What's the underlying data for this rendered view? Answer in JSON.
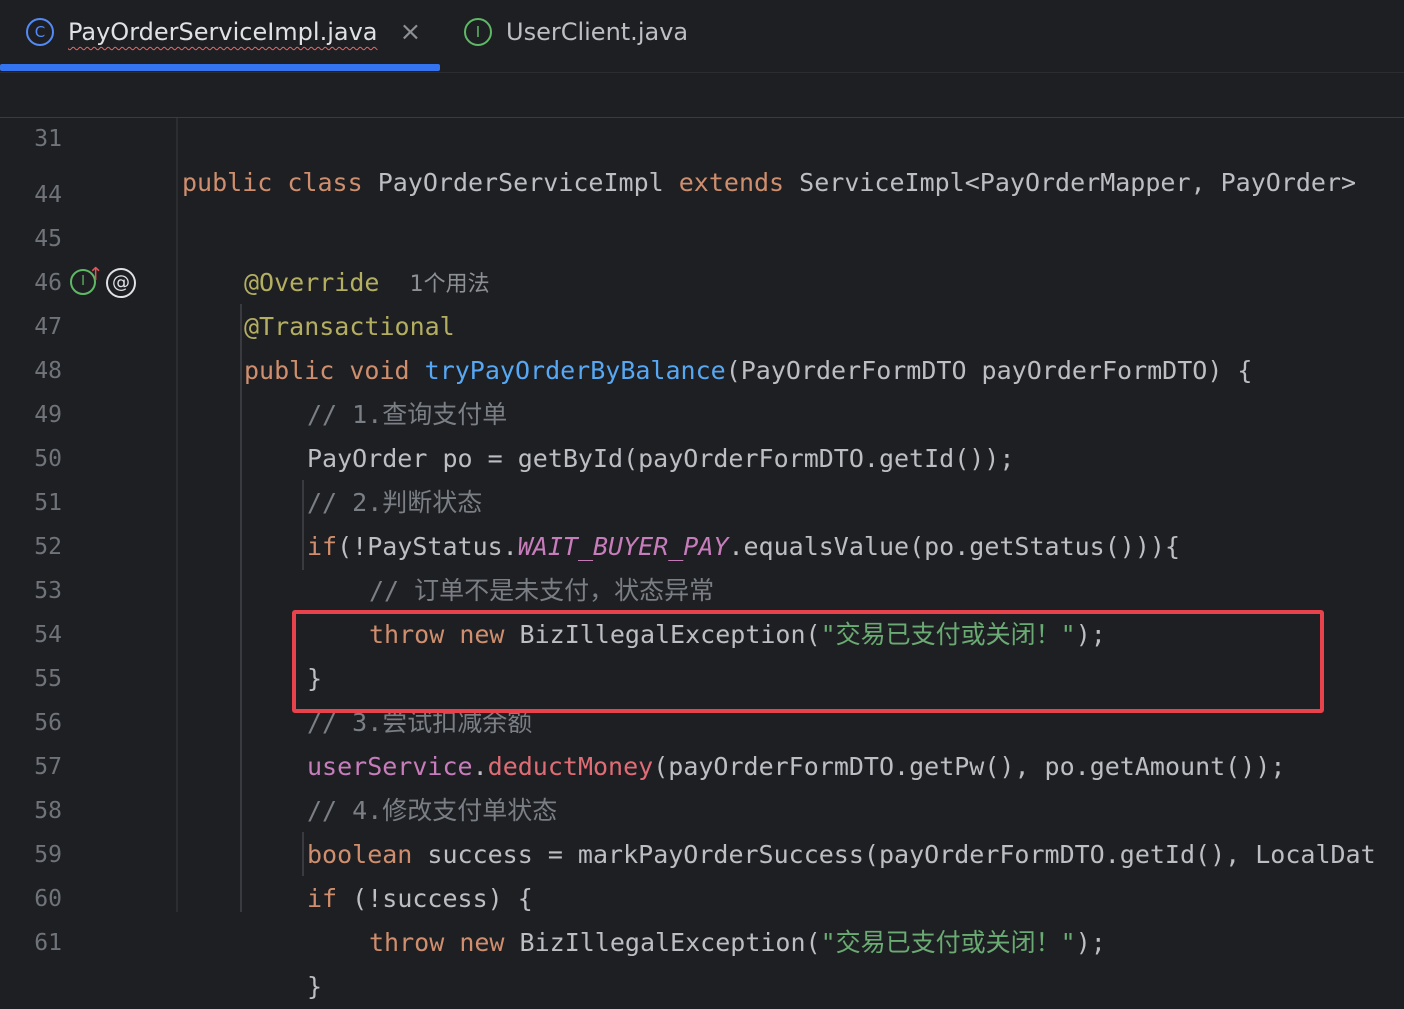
{
  "tabs": [
    {
      "label": "PayOrderServiceImpl.java",
      "icon": "class-icon",
      "icon_glyph": "C",
      "active": true,
      "close": "×"
    },
    {
      "label": "UserClient.java",
      "icon": "interface-icon",
      "icon_glyph": "I",
      "active": false
    }
  ],
  "sticky": {
    "line_number": "31",
    "kw1": "public",
    "kw2": "class",
    "name": "PayOrderServiceImpl",
    "kw3": "extends",
    "rest": "ServiceImpl<PayOrderMapper, PayOrder>"
  },
  "gutter": {
    "implements_marker": "I",
    "override_arrow": "↑",
    "annotation_marker": "@"
  },
  "lines": {
    "l44": {
      "n": "44"
    },
    "l45": {
      "n": "45",
      "ann": "@Override",
      "hint": "1个用法"
    },
    "l46": {
      "n": "46",
      "ann": "@Transactional"
    },
    "l47": {
      "n": "47",
      "kw1": "public",
      "kw2": "void",
      "fn": "tryPayOrderByBalance",
      "rest": "(PayOrderFormDTO payOrderFormDTO) {"
    },
    "l48": {
      "n": "48",
      "cm": "// 1.查询支付单"
    },
    "l49": {
      "n": "49",
      "code": "PayOrder po = getById(payOrderFormDTO.getId());"
    },
    "l50": {
      "n": "50",
      "cm": "// 2.判断状态"
    },
    "l51": {
      "n": "51",
      "kw": "if",
      "a": "(!PayStatus.",
      "st": "WAIT_BUYER_PAY",
      "b": ".equalsValue(po.getStatus())){"
    },
    "l52": {
      "n": "52",
      "cm": "// 订单不是未支付，状态异常"
    },
    "l53": {
      "n": "53",
      "kw1": "throw",
      "kw2": "new",
      "a": "BizIllegalException(",
      "str": "\"交易已支付或关闭！\"",
      "b": ");"
    },
    "l54": {
      "n": "54",
      "code": "}"
    },
    "l55": {
      "n": "55",
      "cm": "// 3.尝试扣减余额"
    },
    "l56": {
      "n": "56",
      "mem": "userService",
      "dot": ".",
      "call": "deductMoney",
      "rest": "(payOrderFormDTO.getPw(), po.getAmount());"
    },
    "l57": {
      "n": "57",
      "cm": "// 4.修改支付单状态"
    },
    "l58": {
      "n": "58",
      "kw": "boolean",
      "rest": "success = markPayOrderSuccess(payOrderFormDTO.getId(), LocalDat"
    },
    "l59": {
      "n": "59",
      "kw": "if",
      "rest": "(!success) {"
    },
    "l60": {
      "n": "60",
      "kw1": "throw",
      "kw2": "new",
      "a": "BizIllegalException(",
      "str": "\"交易已支付或关闭！\"",
      "b": ");"
    },
    "l61": {
      "n": "61",
      "code": "}"
    }
  },
  "colors": {
    "background": "#1e1f22",
    "keyword": "#cf8e6d",
    "annotation": "#b3ae60",
    "method": "#56a8f5",
    "comment": "#7a7e85",
    "string": "#6aab73",
    "highlight_box": "#e8424d",
    "tab_indicator": "#3574f0"
  }
}
